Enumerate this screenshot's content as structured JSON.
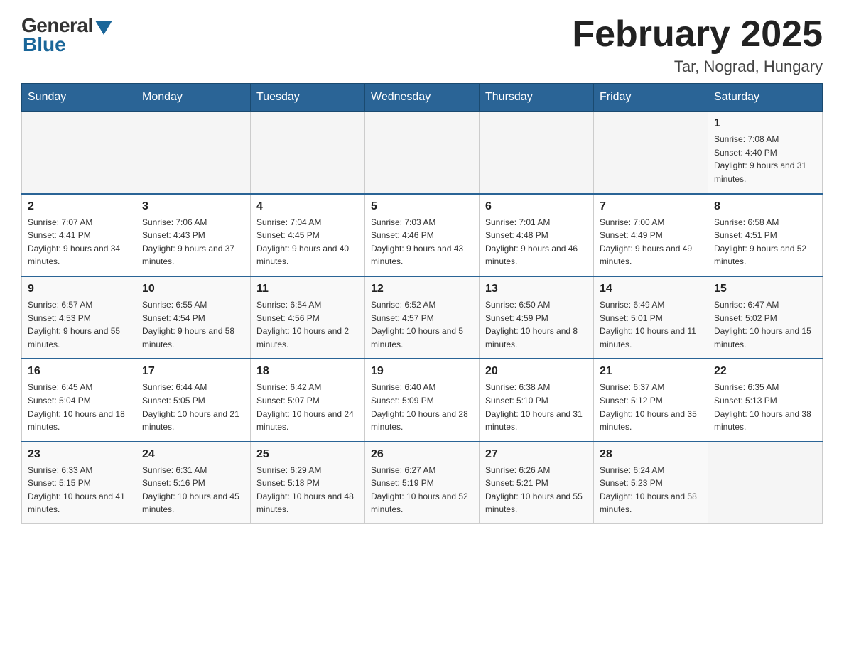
{
  "header": {
    "logo_general": "General",
    "logo_blue": "Blue",
    "month_title": "February 2025",
    "location": "Tar, Nograd, Hungary"
  },
  "days_of_week": [
    "Sunday",
    "Monday",
    "Tuesday",
    "Wednesday",
    "Thursday",
    "Friday",
    "Saturday"
  ],
  "weeks": [
    [
      {
        "day": "",
        "info": ""
      },
      {
        "day": "",
        "info": ""
      },
      {
        "day": "",
        "info": ""
      },
      {
        "day": "",
        "info": ""
      },
      {
        "day": "",
        "info": ""
      },
      {
        "day": "",
        "info": ""
      },
      {
        "day": "1",
        "info": "Sunrise: 7:08 AM\nSunset: 4:40 PM\nDaylight: 9 hours and 31 minutes."
      }
    ],
    [
      {
        "day": "2",
        "info": "Sunrise: 7:07 AM\nSunset: 4:41 PM\nDaylight: 9 hours and 34 minutes."
      },
      {
        "day": "3",
        "info": "Sunrise: 7:06 AM\nSunset: 4:43 PM\nDaylight: 9 hours and 37 minutes."
      },
      {
        "day": "4",
        "info": "Sunrise: 7:04 AM\nSunset: 4:45 PM\nDaylight: 9 hours and 40 minutes."
      },
      {
        "day": "5",
        "info": "Sunrise: 7:03 AM\nSunset: 4:46 PM\nDaylight: 9 hours and 43 minutes."
      },
      {
        "day": "6",
        "info": "Sunrise: 7:01 AM\nSunset: 4:48 PM\nDaylight: 9 hours and 46 minutes."
      },
      {
        "day": "7",
        "info": "Sunrise: 7:00 AM\nSunset: 4:49 PM\nDaylight: 9 hours and 49 minutes."
      },
      {
        "day": "8",
        "info": "Sunrise: 6:58 AM\nSunset: 4:51 PM\nDaylight: 9 hours and 52 minutes."
      }
    ],
    [
      {
        "day": "9",
        "info": "Sunrise: 6:57 AM\nSunset: 4:53 PM\nDaylight: 9 hours and 55 minutes."
      },
      {
        "day": "10",
        "info": "Sunrise: 6:55 AM\nSunset: 4:54 PM\nDaylight: 9 hours and 58 minutes."
      },
      {
        "day": "11",
        "info": "Sunrise: 6:54 AM\nSunset: 4:56 PM\nDaylight: 10 hours and 2 minutes."
      },
      {
        "day": "12",
        "info": "Sunrise: 6:52 AM\nSunset: 4:57 PM\nDaylight: 10 hours and 5 minutes."
      },
      {
        "day": "13",
        "info": "Sunrise: 6:50 AM\nSunset: 4:59 PM\nDaylight: 10 hours and 8 minutes."
      },
      {
        "day": "14",
        "info": "Sunrise: 6:49 AM\nSunset: 5:01 PM\nDaylight: 10 hours and 11 minutes."
      },
      {
        "day": "15",
        "info": "Sunrise: 6:47 AM\nSunset: 5:02 PM\nDaylight: 10 hours and 15 minutes."
      }
    ],
    [
      {
        "day": "16",
        "info": "Sunrise: 6:45 AM\nSunset: 5:04 PM\nDaylight: 10 hours and 18 minutes."
      },
      {
        "day": "17",
        "info": "Sunrise: 6:44 AM\nSunset: 5:05 PM\nDaylight: 10 hours and 21 minutes."
      },
      {
        "day": "18",
        "info": "Sunrise: 6:42 AM\nSunset: 5:07 PM\nDaylight: 10 hours and 24 minutes."
      },
      {
        "day": "19",
        "info": "Sunrise: 6:40 AM\nSunset: 5:09 PM\nDaylight: 10 hours and 28 minutes."
      },
      {
        "day": "20",
        "info": "Sunrise: 6:38 AM\nSunset: 5:10 PM\nDaylight: 10 hours and 31 minutes."
      },
      {
        "day": "21",
        "info": "Sunrise: 6:37 AM\nSunset: 5:12 PM\nDaylight: 10 hours and 35 minutes."
      },
      {
        "day": "22",
        "info": "Sunrise: 6:35 AM\nSunset: 5:13 PM\nDaylight: 10 hours and 38 minutes."
      }
    ],
    [
      {
        "day": "23",
        "info": "Sunrise: 6:33 AM\nSunset: 5:15 PM\nDaylight: 10 hours and 41 minutes."
      },
      {
        "day": "24",
        "info": "Sunrise: 6:31 AM\nSunset: 5:16 PM\nDaylight: 10 hours and 45 minutes."
      },
      {
        "day": "25",
        "info": "Sunrise: 6:29 AM\nSunset: 5:18 PM\nDaylight: 10 hours and 48 minutes."
      },
      {
        "day": "26",
        "info": "Sunrise: 6:27 AM\nSunset: 5:19 PM\nDaylight: 10 hours and 52 minutes."
      },
      {
        "day": "27",
        "info": "Sunrise: 6:26 AM\nSunset: 5:21 PM\nDaylight: 10 hours and 55 minutes."
      },
      {
        "day": "28",
        "info": "Sunrise: 6:24 AM\nSunset: 5:23 PM\nDaylight: 10 hours and 58 minutes."
      },
      {
        "day": "",
        "info": ""
      }
    ]
  ]
}
